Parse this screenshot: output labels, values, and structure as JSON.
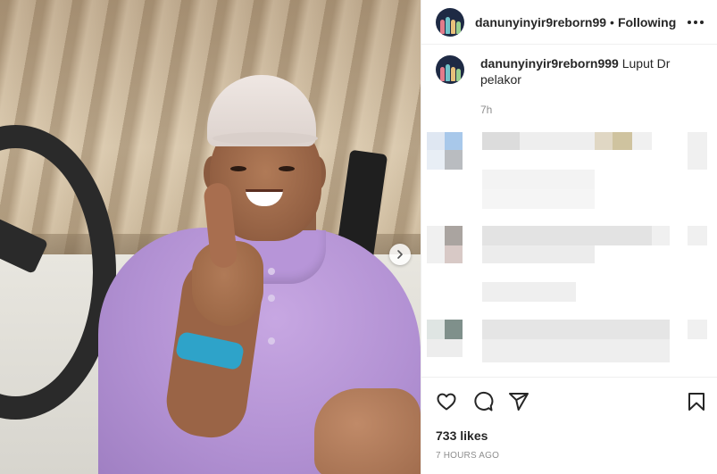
{
  "post": {
    "username": "danunyinyir9reborn99",
    "follow_status": "Following",
    "caption_username": "danunyinyir9reborn999",
    "caption_text": "Luput Dr pelakor",
    "caption_time": "7h",
    "likes": "733 likes",
    "time_ago": "7 HOURS AGO"
  },
  "icons": {
    "more": "more-options-icon",
    "like": "heart-icon",
    "comment": "comment-icon",
    "share": "share-icon",
    "save": "bookmark-icon",
    "next": "chevron-right-icon"
  },
  "colors": {
    "text": "#262626",
    "muted": "#8e8e8e",
    "divider": "#efefef",
    "shirt": "#b291d3"
  }
}
